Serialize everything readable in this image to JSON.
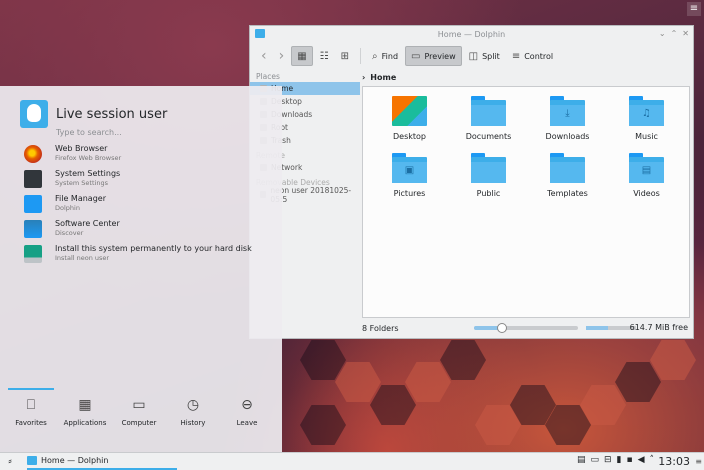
{
  "desktop": {
    "menu_icon": "hamburger-icon"
  },
  "window": {
    "title": "Home — Dolphin",
    "toolbar": {
      "back_icon": "‹",
      "forward_icon": "›",
      "find": "Find",
      "preview": "Preview",
      "split": "Split",
      "control": "Control"
    },
    "places": {
      "header": "Places",
      "items": [
        "Home",
        "Desktop",
        "Downloads",
        "Root",
        "Trash"
      ],
      "remote_header": "Remote",
      "remote_items": [
        "Network"
      ],
      "devices_header": "Removable Devices",
      "device_items": [
        "neon user 20181025-05:5"
      ]
    },
    "breadcrumb": "Home",
    "files": [
      {
        "name": "Desktop",
        "glyph": ""
      },
      {
        "name": "Documents",
        "glyph": ""
      },
      {
        "name": "Downloads",
        "glyph": "⤓"
      },
      {
        "name": "Music",
        "glyph": "♫"
      },
      {
        "name": "Pictures",
        "glyph": "▣"
      },
      {
        "name": "Public",
        "glyph": ""
      },
      {
        "name": "Templates",
        "glyph": ""
      },
      {
        "name": "Videos",
        "glyph": "▤"
      }
    ],
    "status": {
      "count": "8 Folders",
      "free": "614.7 MiB free",
      "zoom_fraction": 0.27,
      "used_fraction": 0.44
    }
  },
  "kickoff": {
    "user": "Live session user",
    "search_placeholder": "Type to search...",
    "favorites": [
      {
        "name": "Web Browser",
        "desc": "Firefox Web Browser",
        "color": "#e66000"
      },
      {
        "name": "System Settings",
        "desc": "System Settings",
        "color": "#31363b"
      },
      {
        "name": "File Manager",
        "desc": "Dolphin",
        "color": "#1d99f3"
      },
      {
        "name": "Software Center",
        "desc": "Discover",
        "color": "#2980b9"
      },
      {
        "name": "Install this system permanently to your hard disk",
        "desc": "Install neon user",
        "color": "#16a085"
      }
    ],
    "tabs": [
      {
        "label": "Favorites",
        "icon": "bookmark-icon"
      },
      {
        "label": "Applications",
        "icon": "grid-icon"
      },
      {
        "label": "Computer",
        "icon": "monitor-icon"
      },
      {
        "label": "History",
        "icon": "clock-icon"
      },
      {
        "label": "Leave",
        "icon": "arrow-left-circle-icon"
      }
    ]
  },
  "panel": {
    "task_title": "Home — Dolphin",
    "clock": "13:03"
  },
  "colors": {
    "accent": "#3daee9",
    "selection": "#8ec4ea",
    "folder": "#3daee9"
  }
}
